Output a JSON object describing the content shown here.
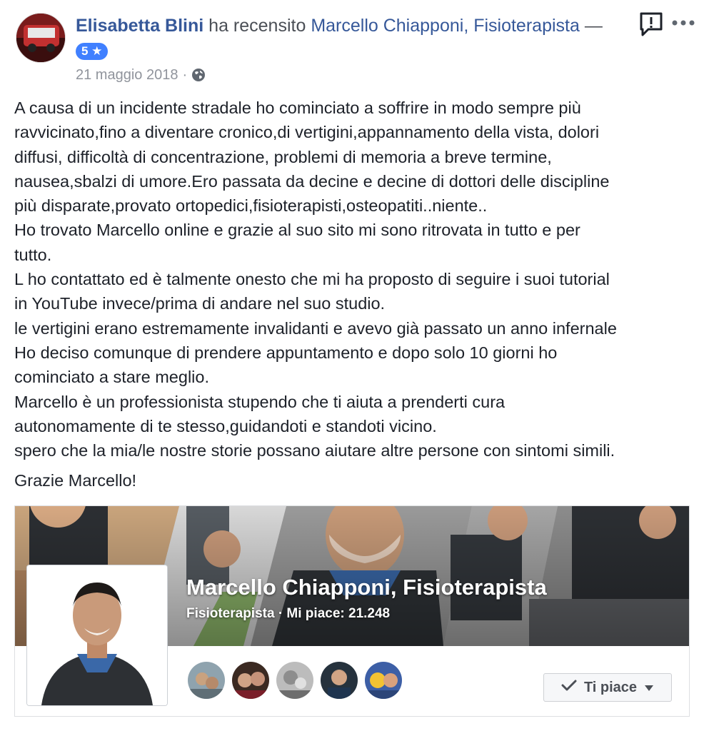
{
  "review": {
    "author": "Elisabetta Blini",
    "action": " ha recensito ",
    "page": "Marcello Chiapponi, Fisioterapista",
    "dash": " —",
    "rating": "5 ★",
    "date": "21 maggio 2018",
    "separator": "·",
    "lines": [
      "A causa di un incidente stradale ho cominciato a soffrire in modo sempre più",
      "ravvicinato,fino a diventare cronico,di vertigini,appannamento della vista, dolori",
      "diffusi, difficoltà di concentrazione, problemi di memoria a breve termine,",
      "nausea,sbalzi di umore.Ero passata da decine e decine di dottori delle discipline",
      "più disparate,provato ortopedici,fisioterapisti,osteopatiti..niente..",
      "Ho trovato Marcello online e grazie al suo sito mi sono ritrovata in tutto e per",
      "tutto.",
      "L ho contattato ed è talmente onesto che mi ha proposto di seguire i suoi tutorial",
      "in YouTube invece/prima di andare nel suo studio.",
      "le vertigini erano estremamente invalidanti e avevo già passato un anno infernale",
      "Ho deciso comunque di prendere appuntamento e dopo solo 10 giorni ho",
      "cominciato a stare meglio.",
      "Marcello è un professionista stupendo che ti aiuta a prenderti cura",
      "autonomamente di te stesso,guidandoti e standoti vicino.",
      "spero che la mia/le nostre storie possano aiutare altre persone con sintomi simili."
    ],
    "closing": "Grazie Marcello!"
  },
  "page_card": {
    "name": "Marcello Chiapponi, Fisioterapista",
    "meta": "Fisioterapista · Mi piace: 21.248",
    "like_label": "Ti piace"
  },
  "icons": {
    "globe": "globe-icon",
    "report": "report-icon",
    "more": "more-icon",
    "check": "check-icon",
    "caret": "caret-down-icon"
  },
  "colors": {
    "link": "#365899",
    "badge": "#4080ff",
    "muted": "#90949c",
    "text": "#1d2129"
  }
}
